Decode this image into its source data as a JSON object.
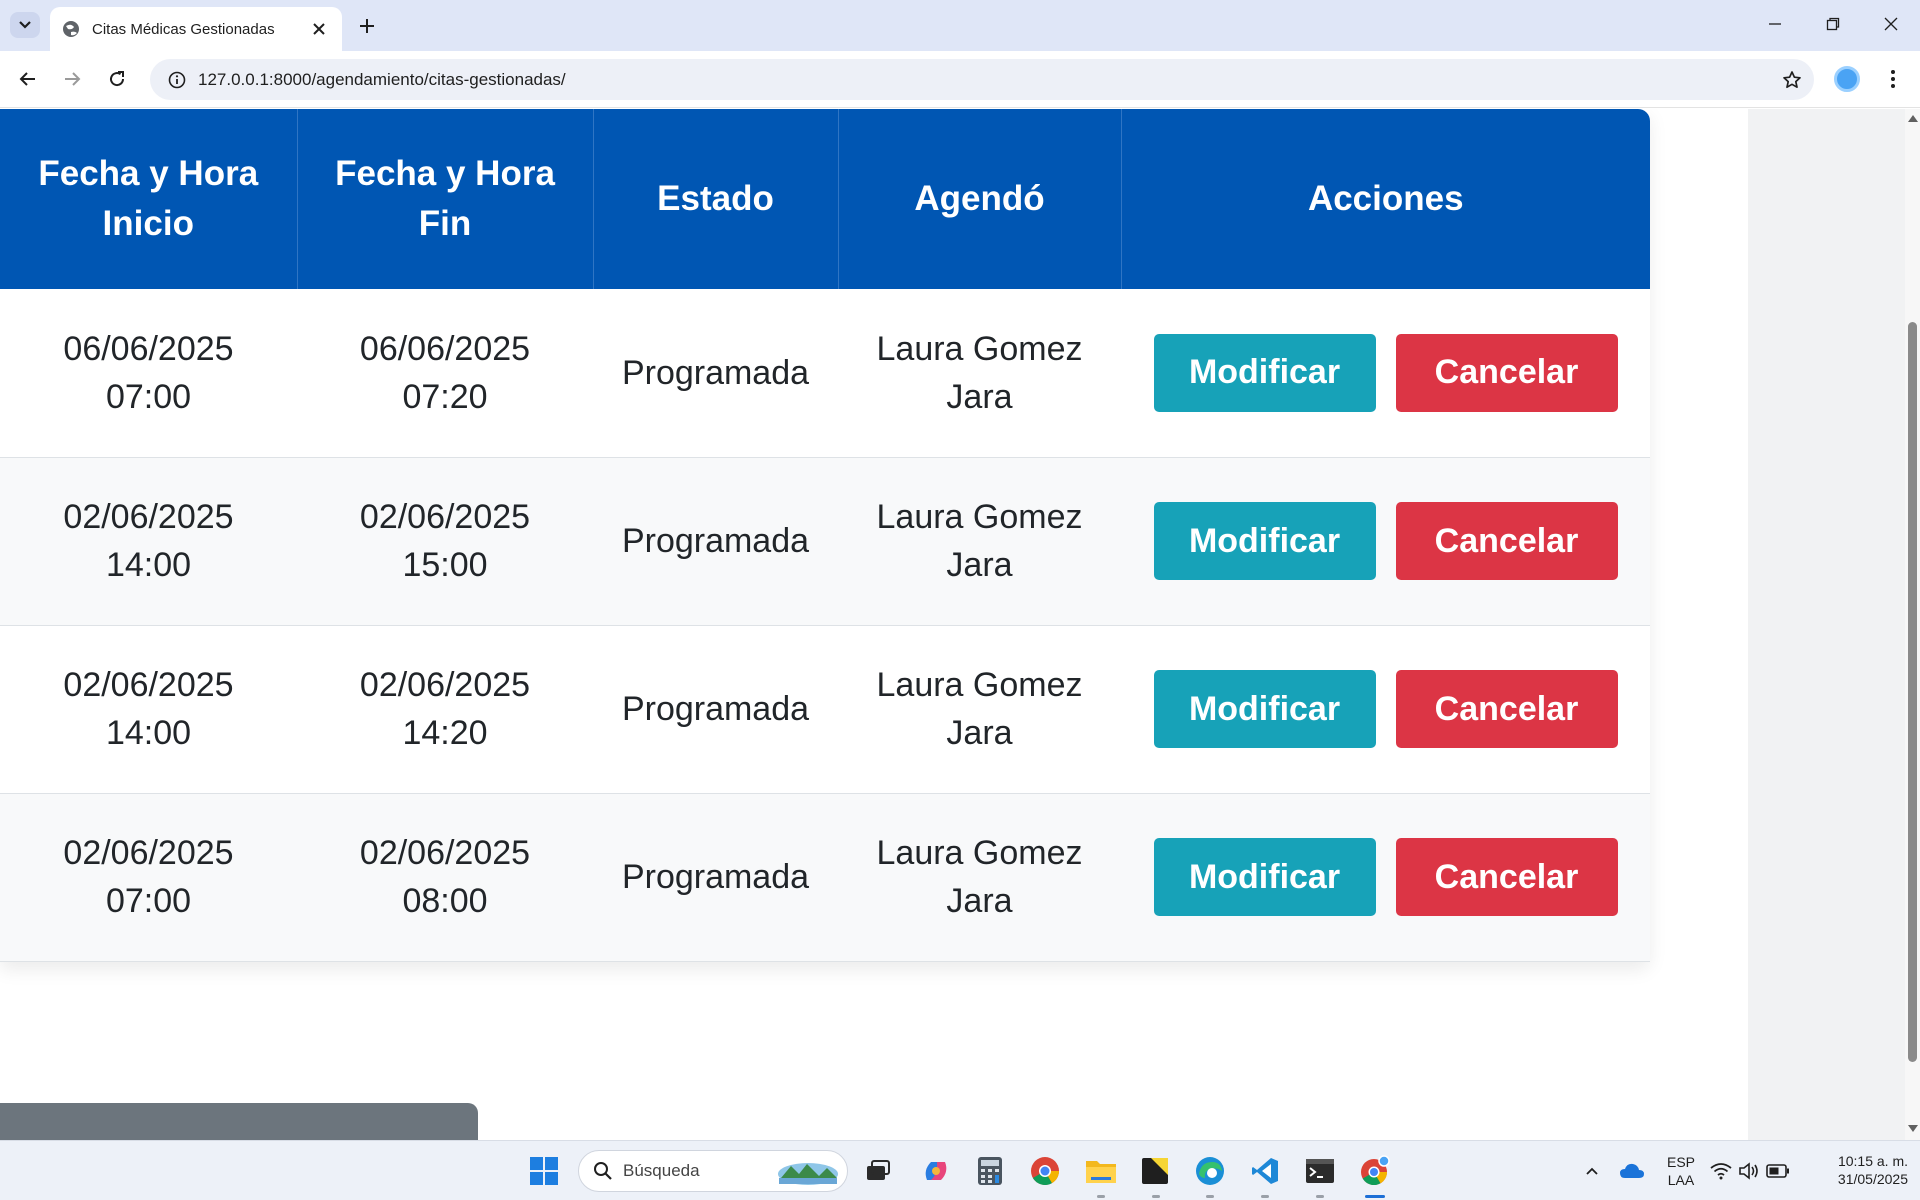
{
  "browser": {
    "tab_title": "Citas Médicas Gestionadas",
    "url": "127.0.0.1:8000/agendamiento/citas-gestionadas/"
  },
  "table": {
    "headers": {
      "start": "Fecha y Hora Inicio",
      "end": "Fecha y Hora Fin",
      "status": "Estado",
      "scheduled_by": "Agendó",
      "actions": "Acciones"
    },
    "rows": [
      {
        "start_date": "06/06/2025",
        "start_time": "07:00",
        "end_date": "06/06/2025",
        "end_time": "07:20",
        "status": "Programada",
        "scheduled_by": "Laura Gomez Jara"
      },
      {
        "start_date": "02/06/2025",
        "start_time": "14:00",
        "end_date": "02/06/2025",
        "end_time": "15:00",
        "status": "Programada",
        "scheduled_by": "Laura Gomez Jara"
      },
      {
        "start_date": "02/06/2025",
        "start_time": "14:00",
        "end_date": "02/06/2025",
        "end_time": "14:20",
        "status": "Programada",
        "scheduled_by": "Laura Gomez Jara"
      },
      {
        "start_date": "02/06/2025",
        "start_time": "07:00",
        "end_date": "02/06/2025",
        "end_time": "08:00",
        "status": "Programada",
        "scheduled_by": "Laura Gomez Jara"
      }
    ],
    "modify_label": "Modificar",
    "cancel_label": "Cancelar"
  },
  "colors": {
    "header_bg": "#0056b3",
    "modify_btn": "#17a2b8",
    "cancel_btn": "#dc3545"
  },
  "taskbar": {
    "search_placeholder": "Búsqueda",
    "lang_top": "ESP",
    "lang_bottom": "LAA",
    "time": "10:15 a. m.",
    "date": "31/05/2025"
  }
}
